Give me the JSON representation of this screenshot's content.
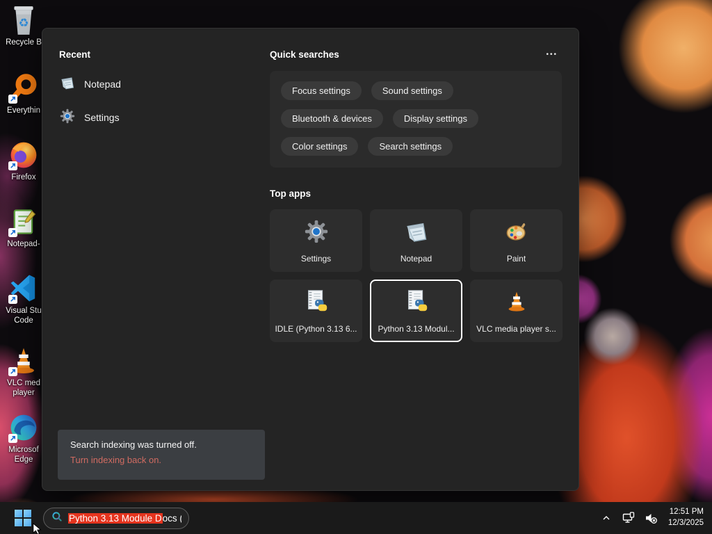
{
  "desktop_icons": [
    {
      "name": "recycle-bin",
      "label": "Recycle B"
    },
    {
      "name": "everything",
      "label": "Everythin"
    },
    {
      "name": "firefox",
      "label": "Firefox"
    },
    {
      "name": "notepad-plus-plus",
      "label": "Notepad-"
    },
    {
      "name": "visual-studio-code",
      "label": "Visual Stu Code"
    },
    {
      "name": "vlc-media-player",
      "label": "VLC med player"
    },
    {
      "name": "microsoft-edge",
      "label": "Microsof Edge"
    }
  ],
  "search_panel": {
    "recent": {
      "title": "Recent",
      "items": [
        {
          "label": "Notepad",
          "icon": "notepad-icon"
        },
        {
          "label": "Settings",
          "icon": "settings-gear-icon"
        }
      ]
    },
    "quick_searches": {
      "title": "Quick searches",
      "more_label": "•••",
      "pills": [
        "Focus settings",
        "Sound settings",
        "Bluetooth & devices",
        "Display settings",
        "Color settings",
        "Search settings"
      ]
    },
    "top_apps": {
      "title": "Top apps",
      "tiles": [
        {
          "label": "Settings",
          "icon": "settings-gear-icon",
          "selected": false
        },
        {
          "label": "Notepad",
          "icon": "notepad-icon",
          "selected": false
        },
        {
          "label": "Paint",
          "icon": "paint-palette-icon",
          "selected": false
        },
        {
          "label": "IDLE (Python 3.13 6...",
          "icon": "python-doc-icon",
          "selected": false
        },
        {
          "label": "Python 3.13 Modul...",
          "icon": "python-doc-icon",
          "selected": true
        },
        {
          "label": "VLC media player s...",
          "icon": "vlc-cone-icon",
          "selected": false
        }
      ]
    },
    "indexing_notice": {
      "message": "Search indexing was turned off.",
      "link": "Turn indexing back on."
    }
  },
  "taskbar": {
    "search": {
      "value_highlighted": "Python 3.13 Module D",
      "value_rest": "ocs ("
    },
    "tray": {
      "time": "12:51 PM",
      "date": "12/3/2025"
    }
  },
  "colors": {
    "selection_highlight": "#e5341e",
    "notice_link": "#d06b61",
    "selected_tile_border": "#ffffff",
    "start_logo_blue": "#57b3f7",
    "panel_bg": "#242424",
    "taskbar_bg": "#1a1a1a"
  }
}
